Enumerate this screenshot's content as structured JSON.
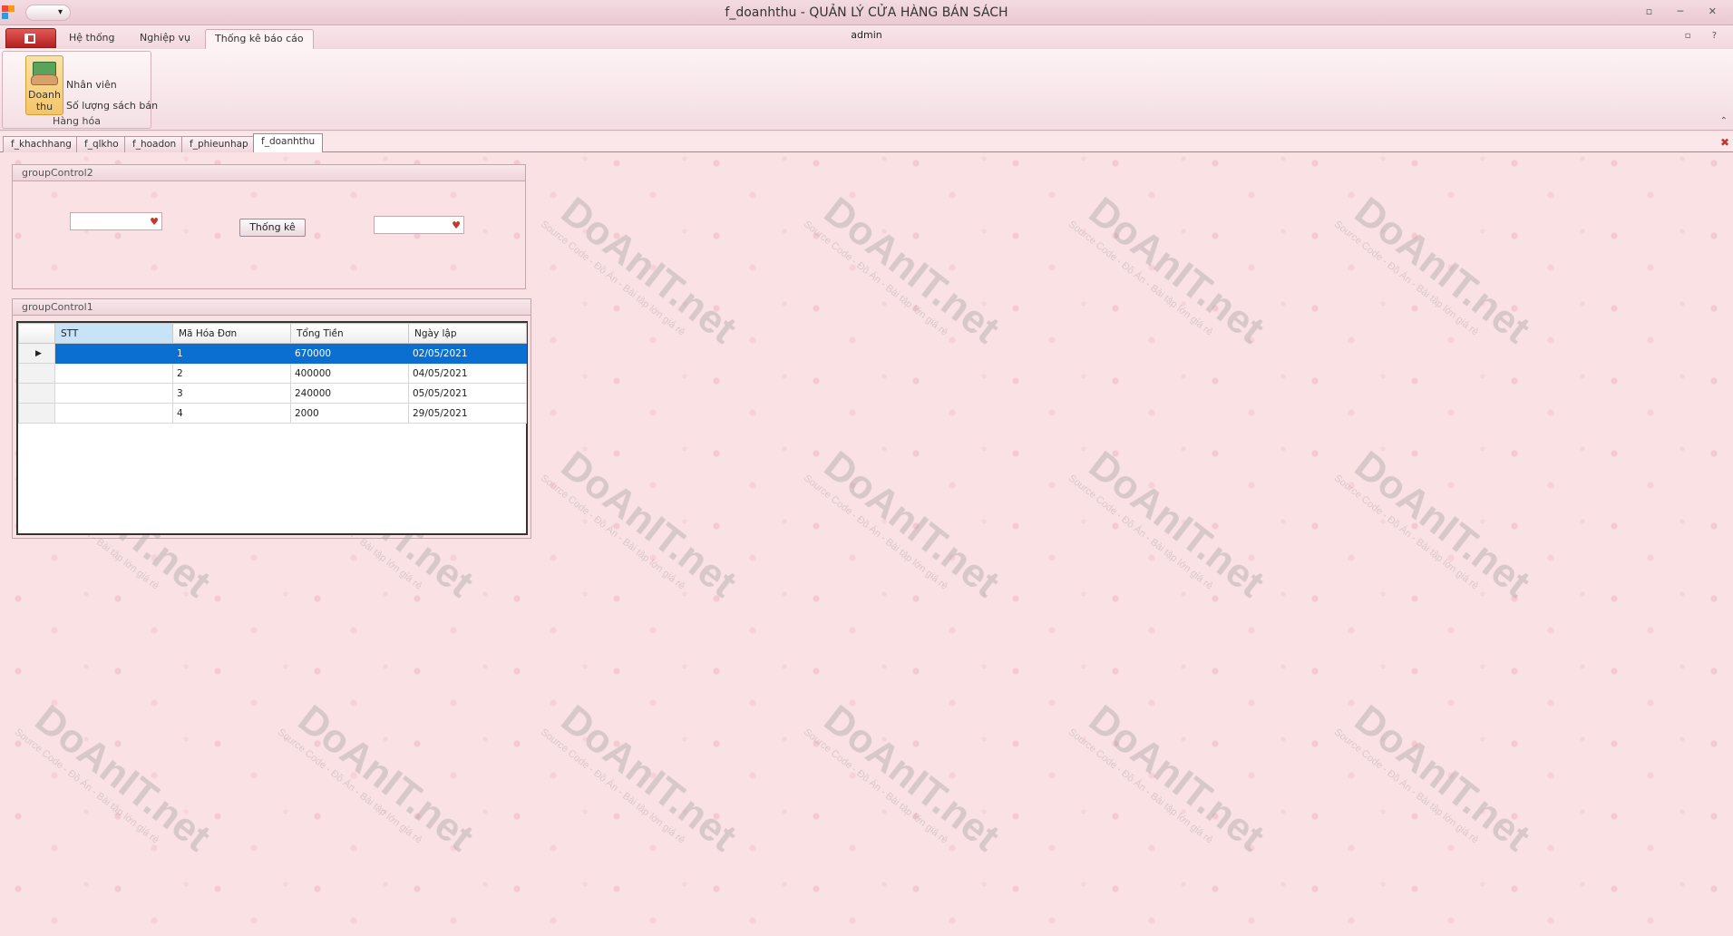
{
  "window": {
    "title_form": "f_doanhthu",
    "title_sep": " - ",
    "title_app": "QUẢN LÝ CỬA HÀNG BÁN SÁCH",
    "qat_label": "▾",
    "controls": "▫ ─ ✕"
  },
  "ribbon": {
    "tabs": [
      "Hệ thống",
      "Nghiệp vụ",
      "Thống kê báo cáo"
    ],
    "active_tab": "Thống kê báo cáo",
    "user": "admin",
    "help": "▫ ?",
    "group_caption": "Hàng hóa",
    "big_button_line1": "Doanh",
    "big_button_line2": "thu",
    "small_buttons": [
      "Nhân viên",
      "Số lượng sách bán"
    ],
    "collapse": "⌃"
  },
  "mdi_tabs": [
    "f_khachhang",
    "f_qlkho",
    "f_hoadon",
    "f_phieunhap",
    "f_doanhthu"
  ],
  "active_mdi_tab": "f_doanhthu",
  "group2": {
    "caption": "groupControl2",
    "combo1_value": "",
    "combo2_value": "",
    "button_label": "Thống kê",
    "combo_icon": "heart-icon"
  },
  "group1": {
    "caption": "groupControl1",
    "columns": [
      "STT",
      "Mã Hóa Đơn",
      "Tổng Tiền",
      "Ngày lập"
    ],
    "rows": [
      {
        "stt": "",
        "ma": "1",
        "tong": "670000",
        "ngay": "02/05/2021"
      },
      {
        "stt": "",
        "ma": "2",
        "tong": "400000",
        "ngay": "04/05/2021"
      },
      {
        "stt": "",
        "ma": "3",
        "tong": "240000",
        "ngay": "05/05/2021"
      },
      {
        "stt": "",
        "ma": "4",
        "tong": "2000",
        "ngay": "29/05/2021"
      }
    ],
    "selected_row_marker": "▶"
  },
  "watermark": {
    "text": "DoAnIT.net",
    "subtext": "Source Code - Đồ Án - Bài tập lớn giá rẻ"
  },
  "colors": {
    "selection": "#0a6fd0",
    "background": "#fae1e4",
    "app_button": "#b3201f"
  }
}
